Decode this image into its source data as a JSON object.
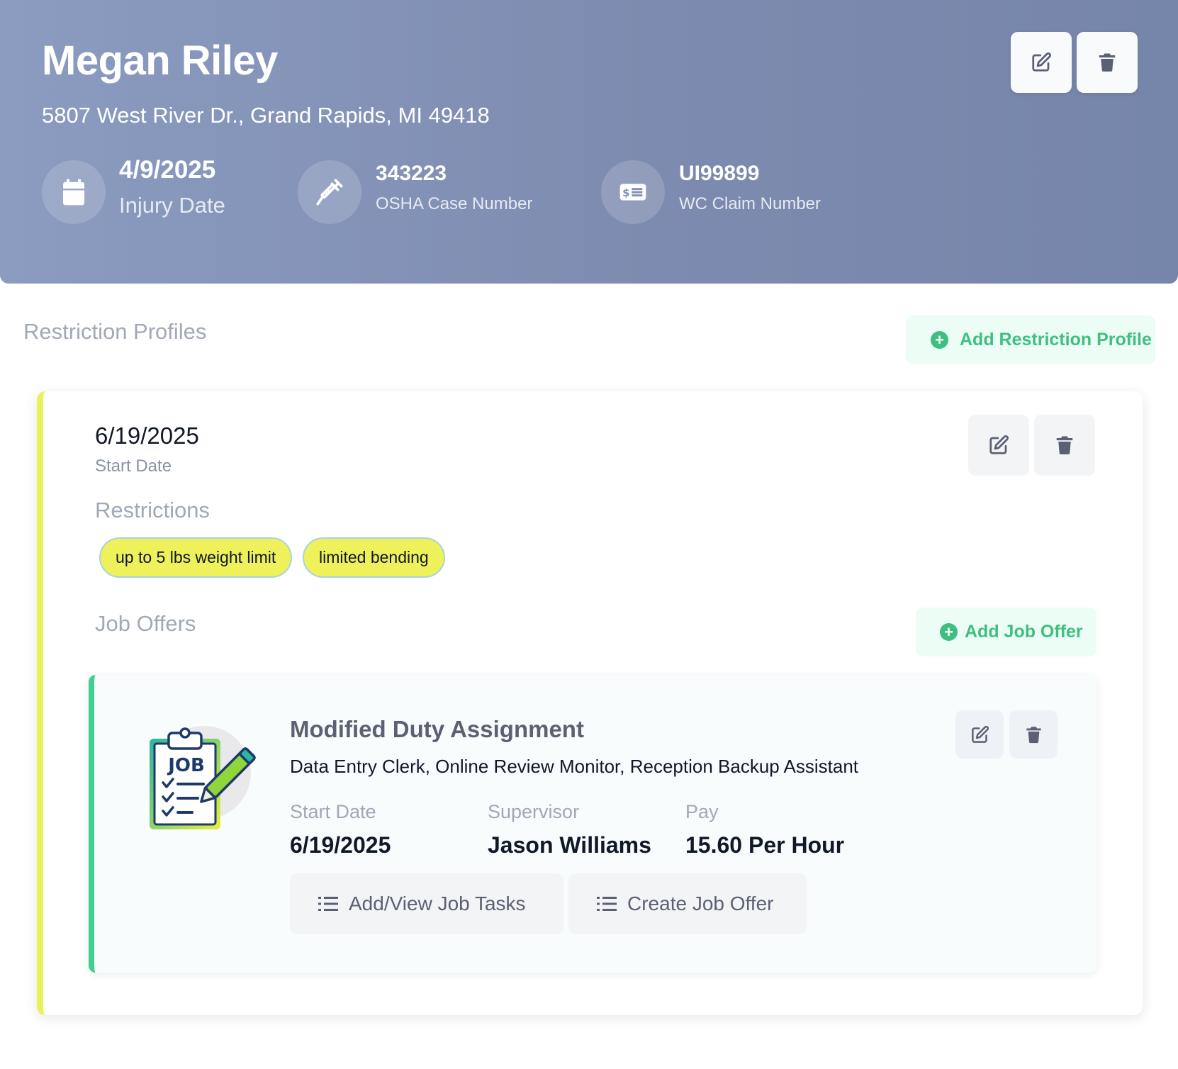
{
  "header": {
    "name": "Megan Riley",
    "address": "5807 West River Dr., Grand Rapids, MI 49418",
    "stats": [
      {
        "icon": "calendar-icon",
        "value": "4/9/2025",
        "label": "Injury Date"
      },
      {
        "icon": "syringe-icon",
        "value": "343223",
        "label": "OSHA Case Number"
      },
      {
        "icon": "money-check-icon",
        "value": "UI99899",
        "label": "WC Claim Number"
      }
    ],
    "edit_icon": "edit-icon",
    "delete_icon": "trash-icon"
  },
  "restriction_profiles": {
    "title": "Restriction Profiles",
    "add_label": "Add Restriction Profile",
    "profile": {
      "start_date": "6/19/2025",
      "start_date_label": "Start Date",
      "restrictions_title": "Restrictions",
      "restrictions": [
        "up to 5 lbs weight limit",
        "limited bending"
      ],
      "job_offers_title": "Job Offers",
      "add_job_offer_label": "Add Job Offer",
      "job_offer": {
        "icon_text": "JOB",
        "title": "Modified Duty Assignment",
        "description": "Data Entry Clerk, Online Review Monitor, Reception Backup Assistant",
        "fields": [
          {
            "label": "Start Date",
            "value": "6/19/2025"
          },
          {
            "label": "Supervisor",
            "value": "Jason Williams"
          },
          {
            "label": "Pay",
            "value": "15.60 Per Hour"
          }
        ],
        "tasks_label": "Add/View Job Tasks",
        "create_label": "Create Job Offer"
      }
    }
  },
  "colors": {
    "header_bg": "#8090b6",
    "accent_green": "#3fbf7f",
    "chip_yellow": "#eef15a",
    "profile_border": "#e7f35a",
    "job_border": "#3fcf8e",
    "icon_gray": "#5b6173"
  }
}
